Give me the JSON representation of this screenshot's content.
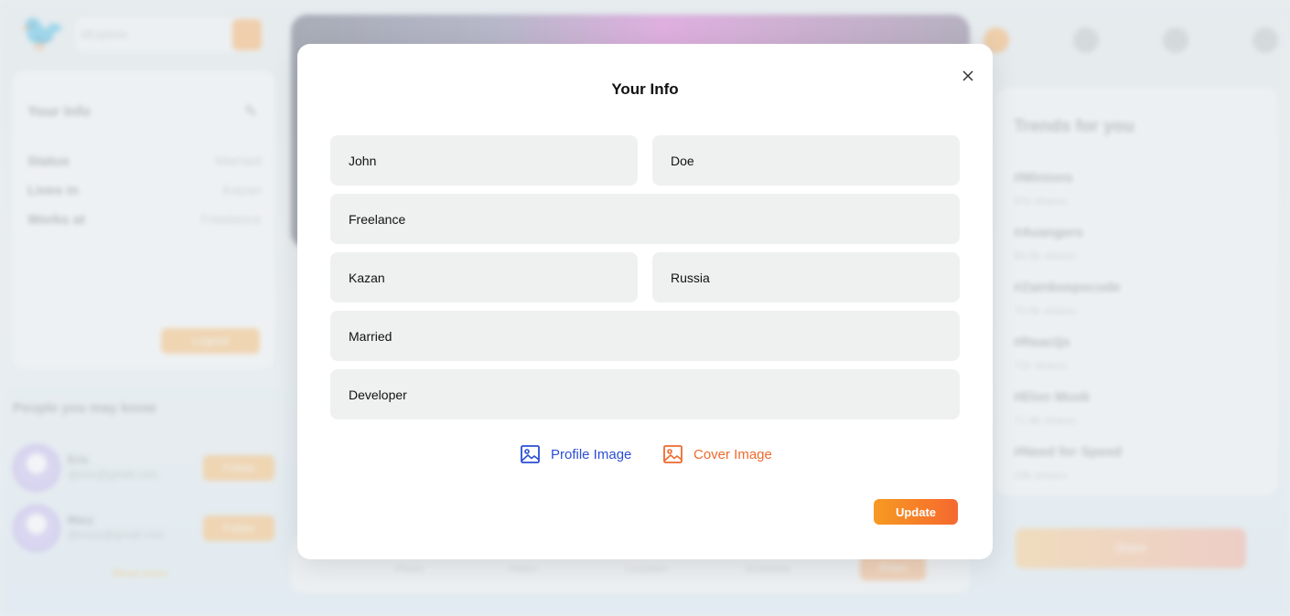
{
  "background": {
    "search_placeholder": "#Explore",
    "info_card": {
      "title": "Your Info",
      "rows": [
        {
          "label": "Status",
          "value": "Married"
        },
        {
          "label": "Lives in",
          "value": "Kazan"
        },
        {
          "label": "Works at",
          "value": "Freelance"
        }
      ],
      "logout_label": "Logout"
    },
    "people_title": "People you may know",
    "people": [
      {
        "name": "Eris",
        "email": "@eric@gmail.com",
        "follow_label": "Follow"
      },
      {
        "name": "Mary",
        "email": "@mary@gmail.com",
        "follow_label": "Follow"
      }
    ],
    "show_more": "Show more",
    "post_options": [
      "Photo",
      "Video",
      "Location",
      "Schedule"
    ],
    "post_share_label": "Share",
    "trends_title": "Trends for you",
    "trends": [
      {
        "tag": "#Minions",
        "shares": "97k shares"
      },
      {
        "tag": "#Avangers",
        "shares": "80.5k shares"
      },
      {
        "tag": "#Zainkeepscode",
        "shares": "75.5k shares"
      },
      {
        "tag": "#Reactjs",
        "shares": "72k shares"
      },
      {
        "tag": "#Elon Musk",
        "shares": "71.9k shares"
      },
      {
        "tag": "#Need for Speed",
        "shares": "20k shares"
      }
    ],
    "share_button_label": "Share"
  },
  "modal": {
    "title": "Your Info",
    "fields": {
      "first_name": "John",
      "last_name": "Doe",
      "works_at": "Freelance",
      "lives_in": "Kazan",
      "country": "Russia",
      "relationship": "Married",
      "about": "Developer"
    },
    "profile_image_label": "Profile Image",
    "cover_image_label": "Cover Image",
    "update_label": "Update"
  },
  "colors": {
    "accent_orange": "#f5682e",
    "accent_blue": "#2b4fd4",
    "field_bg": "#eff1f0"
  }
}
